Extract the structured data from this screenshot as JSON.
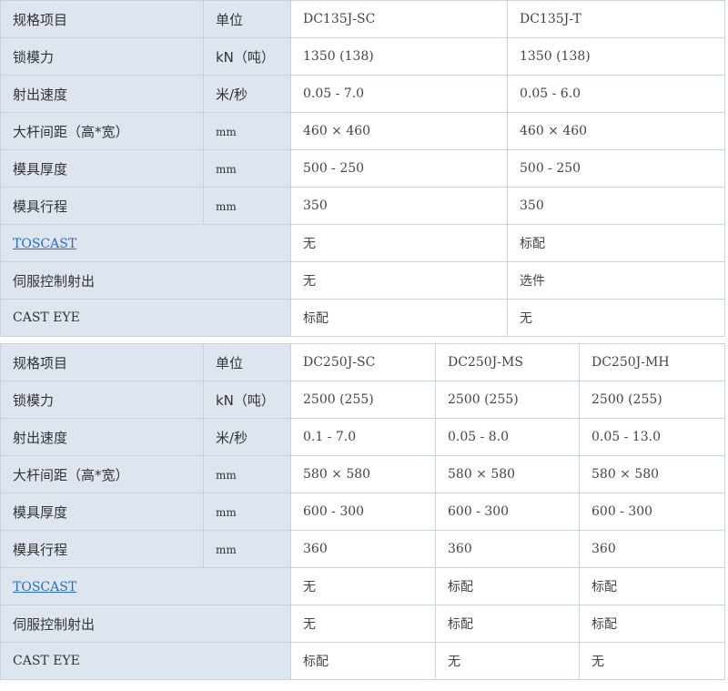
{
  "table1": {
    "header": [
      "规格项目",
      "单位",
      "DC135J-SC",
      "DC135J-T"
    ],
    "rows": [
      {
        "label": "锁模力",
        "unit": "kN（吨）",
        "values": [
          "1350 (138)",
          "1350 (138)"
        ]
      },
      {
        "label": "射出速度",
        "unit": "米/秒",
        "values": [
          "0.05 - 7.0",
          "0.05 - 6.0"
        ]
      },
      {
        "label": "大杆间距（高*宽）",
        "unit": "mm",
        "values": [
          "460 × 460",
          "460 × 460"
        ]
      },
      {
        "label": "模具厚度",
        "unit": "mm",
        "values": [
          "500 - 250",
          "500 - 250"
        ]
      },
      {
        "label": "模具行程",
        "unit": "mm",
        "values": [
          "350",
          "350"
        ]
      },
      {
        "label": "TOSCAST",
        "values": [
          "无",
          "标配"
        ]
      },
      {
        "label": "伺服控制射出",
        "values": [
          "无",
          "选件"
        ]
      },
      {
        "label": "CAST EYE",
        "values": [
          "标配",
          "无"
        ]
      }
    ]
  },
  "table2": {
    "header": [
      "规格项目",
      "单位",
      "DC250J-SC",
      "DC250J-MS",
      "DC250J-MH"
    ],
    "rows": [
      {
        "label": "锁模力",
        "unit": "kN（吨）",
        "values": [
          "2500 (255)",
          "2500 (255)",
          "2500 (255)"
        ]
      },
      {
        "label": "射出速度",
        "unit": "米/秒",
        "values": [
          "0.1 - 7.0",
          "0.05 - 8.0",
          "0.05 - 13.0"
        ]
      },
      {
        "label": "大杆间距（高*宽）",
        "unit": "mm",
        "values": [
          "580 × 580",
          "580 × 580",
          "580 × 580"
        ]
      },
      {
        "label": "模具厚度",
        "unit": "mm",
        "values": [
          "600 - 300",
          "600 - 300",
          "600 - 300"
        ]
      },
      {
        "label": "模具行程",
        "unit": "mm",
        "values": [
          "360",
          "360",
          "360"
        ]
      },
      {
        "label": "TOSCAST",
        "values": [
          "无",
          "标配",
          "标配"
        ]
      },
      {
        "label": "伺服控制射出",
        "values": [
          "无",
          "标配",
          "标配"
        ]
      },
      {
        "label": "CAST EYE",
        "values": [
          "标配",
          "无",
          "无"
        ]
      }
    ]
  }
}
